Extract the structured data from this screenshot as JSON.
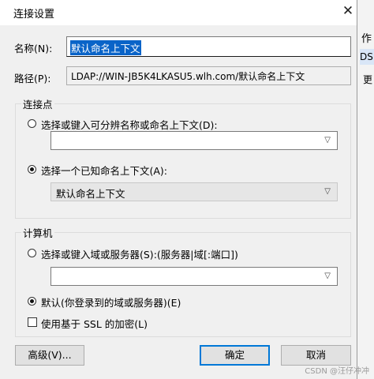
{
  "background": {
    "snippet1": "作",
    "snippet2": "DSI",
    "snippet3": "更"
  },
  "dialog": {
    "title": "连接设置",
    "close_glyph": "✕",
    "name_label": "名称(N):",
    "name_value": "默认命名上下文",
    "path_label": "路径(P):",
    "path_value": "LDAP://WIN-JB5K4LKASU5.wlh.com/默认命名上下文",
    "connection_point": {
      "group_title": "连接点",
      "radio1_label": "选择或键入可分辨名称或命名上下文(D):",
      "radio1_selected": false,
      "combo1_value": "",
      "radio2_label": "选择一个已知命名上下文(A):",
      "radio2_selected": true,
      "combo2_value": "默认命名上下文"
    },
    "computer": {
      "group_title": "计算机",
      "radio1_label": "选择或键入域或服务器(S):(服务器|域[:端口])",
      "radio1_selected": false,
      "combo_value": "",
      "radio2_label": "默认(你登录到的域或服务器)(E)",
      "radio2_selected": true,
      "ssl_label": "使用基于 SSL 的加密(L)",
      "ssl_checked": false
    },
    "buttons": {
      "advanced": "高级(V)...",
      "ok": "确定",
      "cancel": "取消"
    }
  },
  "watermark": "CSDN @汪仔冲冲"
}
